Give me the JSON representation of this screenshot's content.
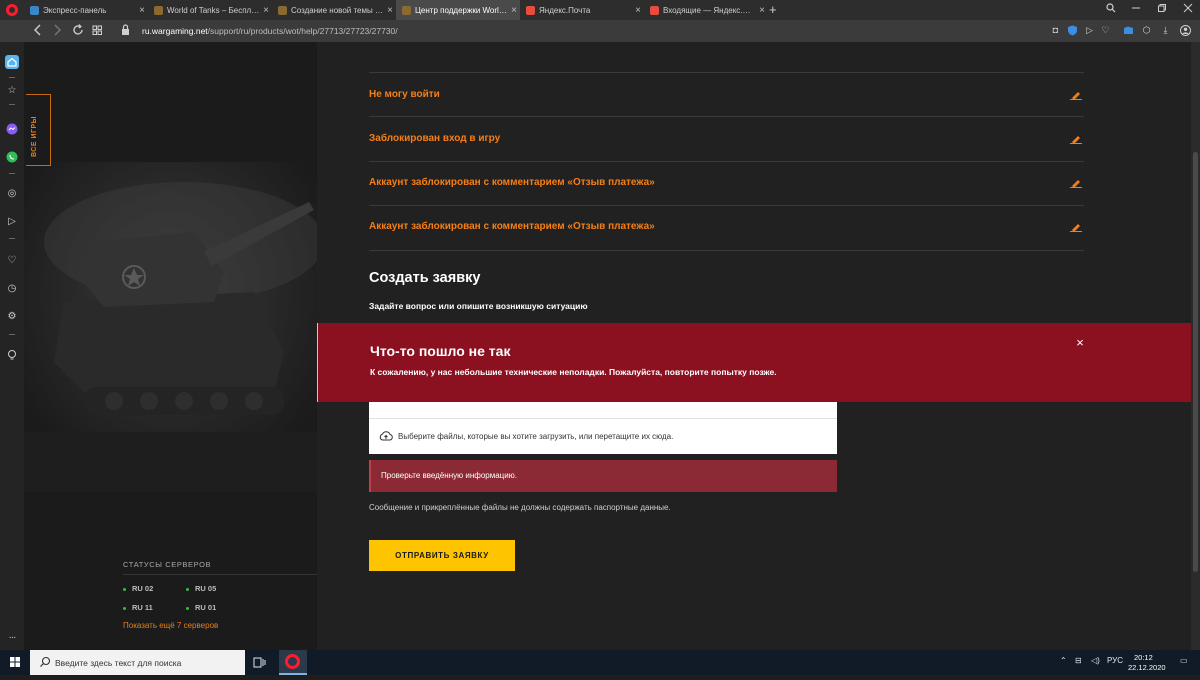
{
  "browser": {
    "tabs": [
      {
        "label": "Экспресс-панель",
        "color": "#3a86c8",
        "active": false
      },
      {
        "label": "World of Tanks – Бесплатн",
        "color": "#8a6a2f",
        "active": false
      },
      {
        "label": "Создание новой темы - С",
        "color": "#8a6a2f",
        "active": false
      },
      {
        "label": "Центр поддержки World o",
        "color": "#8a6a2f",
        "active": true
      },
      {
        "label": "Яндекс.Почта",
        "color": "#e94b3c",
        "active": false
      },
      {
        "label": "Входящие — Яндекс.Почт",
        "color": "#e94b3c",
        "active": false
      }
    ],
    "tab_close": "×",
    "new_tab": "+",
    "url_domain": "ru.wargaming.net",
    "url_path": "/support/ru/products/wot/help/27713/27723/27730/"
  },
  "left_panel": {
    "games_tab": "ВСЕ ИГРЫ",
    "servers_title": "СТАТУСЫ СЕРВЕРОВ",
    "servers": [
      "RU 02",
      "RU 05",
      "RU 11",
      "RU 01"
    ],
    "more_servers": "Показать ещё 7 серверов"
  },
  "faq": {
    "items": [
      "Не могу войти",
      "Заблокирован вход в игру",
      "Аккаунт заблокирован с комментарием «Отзыв платежа»",
      "Аккаунт заблокирован с комментарием «Отзыв платежа»"
    ]
  },
  "form": {
    "title": "Создать заявку",
    "subtitle": "Задайте вопрос или опишите возникшую ситуацию",
    "upload_text": "Выберите файлы, которые вы хотите загрузить, или перетащите их сюда.",
    "validation": "Проверьте введённую информацию.",
    "note": "Сообщение и прикреплённые файлы не должны содержать паспортные данные.",
    "submit": "ОТПРАВИТЬ ЗАЯВКУ"
  },
  "error": {
    "title": "Что-то пошло не так",
    "text": "К сожалению, у нас небольшие технические неполадки. Пожалуйста, повторите попытку позже.",
    "close": "×"
  },
  "taskbar": {
    "search_placeholder": "Введите здесь текст для поиска",
    "lang": "РУС",
    "time": "20:12",
    "date": "22.12.2020"
  },
  "colors": {
    "accent_orange": "#f57f17",
    "error_red": "#8b1020",
    "submit_yellow": "#ffc400"
  }
}
